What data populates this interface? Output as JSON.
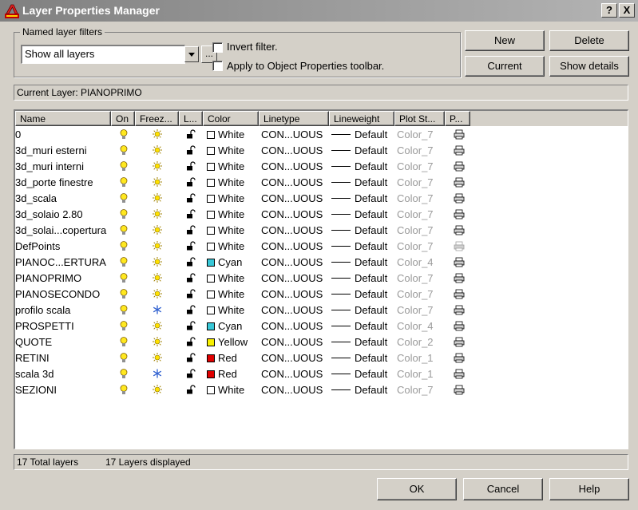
{
  "window": {
    "title": "Layer Properties Manager",
    "help_label": "?",
    "close_label": "X"
  },
  "filters": {
    "group_label": "Named layer filters",
    "selected": "Show all layers",
    "more_label": "...",
    "invert_label": "Invert filter.",
    "apply_label": "Apply to Object Properties toolbar."
  },
  "buttons": {
    "new": "New",
    "delete": "Delete",
    "current": "Current",
    "show_details": "Show details",
    "ok": "OK",
    "cancel": "Cancel",
    "help": "Help"
  },
  "current_layer": "Current Layer:  PIANOPRIMO",
  "columns": [
    "Name",
    "On",
    "Freez...",
    "L...",
    "Color",
    "Linetype",
    "Lineweight",
    "Plot St...",
    "P..."
  ],
  "colors": {
    "White": "#ffffff",
    "Cyan": "#38c8d8",
    "Yellow": "#f8f000",
    "Red": "#e00000"
  },
  "layers": [
    {
      "name": "0",
      "frozen": false,
      "color": "White",
      "linetype": "CON...UOUS",
      "lineweight": "Default",
      "plot_style": "Color_7",
      "plot": true
    },
    {
      "name": "3d_muri esterni",
      "frozen": false,
      "color": "White",
      "linetype": "CON...UOUS",
      "lineweight": "Default",
      "plot_style": "Color_7",
      "plot": true
    },
    {
      "name": "3d_muri interni",
      "frozen": false,
      "color": "White",
      "linetype": "CON...UOUS",
      "lineweight": "Default",
      "plot_style": "Color_7",
      "plot": true
    },
    {
      "name": "3d_porte finestre",
      "frozen": false,
      "color": "White",
      "linetype": "CON...UOUS",
      "lineweight": "Default",
      "plot_style": "Color_7",
      "plot": true
    },
    {
      "name": "3d_scala",
      "frozen": false,
      "color": "White",
      "linetype": "CON...UOUS",
      "lineweight": "Default",
      "plot_style": "Color_7",
      "plot": true
    },
    {
      "name": "3d_solaio 2.80",
      "frozen": false,
      "color": "White",
      "linetype": "CON...UOUS",
      "lineweight": "Default",
      "plot_style": "Color_7",
      "plot": true
    },
    {
      "name": "3d_solai...copertura",
      "frozen": false,
      "color": "White",
      "linetype": "CON...UOUS",
      "lineweight": "Default",
      "plot_style": "Color_7",
      "plot": true
    },
    {
      "name": "DefPoints",
      "frozen": false,
      "color": "White",
      "linetype": "CON...UOUS",
      "lineweight": "Default",
      "plot_style": "Color_7",
      "plot": false
    },
    {
      "name": "PIANOC...ERTURA",
      "frozen": false,
      "color": "Cyan",
      "linetype": "CON...UOUS",
      "lineweight": "Default",
      "plot_style": "Color_4",
      "plot": true
    },
    {
      "name": "PIANOPRIMO",
      "frozen": false,
      "color": "White",
      "linetype": "CON...UOUS",
      "lineweight": "Default",
      "plot_style": "Color_7",
      "plot": true
    },
    {
      "name": "PIANOSECONDO",
      "frozen": false,
      "color": "White",
      "linetype": "CON...UOUS",
      "lineweight": "Default",
      "plot_style": "Color_7",
      "plot": true
    },
    {
      "name": "profilo scala",
      "frozen": true,
      "color": "White",
      "linetype": "CON...UOUS",
      "lineweight": "Default",
      "plot_style": "Color_7",
      "plot": true
    },
    {
      "name": "PROSPETTI",
      "frozen": false,
      "color": "Cyan",
      "linetype": "CON...UOUS",
      "lineweight": "Default",
      "plot_style": "Color_4",
      "plot": true
    },
    {
      "name": "QUOTE",
      "frozen": false,
      "color": "Yellow",
      "linetype": "CON...UOUS",
      "lineweight": "Default",
      "plot_style": "Color_2",
      "plot": true
    },
    {
      "name": "RETINI",
      "frozen": false,
      "color": "Red",
      "linetype": "CON...UOUS",
      "lineweight": "Default",
      "plot_style": "Color_1",
      "plot": true
    },
    {
      "name": "scala 3d",
      "frozen": true,
      "color": "Red",
      "linetype": "CON...UOUS",
      "lineweight": "Default",
      "plot_style": "Color_1",
      "plot": true
    },
    {
      "name": "SEZIONI",
      "frozen": false,
      "color": "White",
      "linetype": "CON...UOUS",
      "lineweight": "Default",
      "plot_style": "Color_7",
      "plot": true
    }
  ],
  "status": {
    "total": "17 Total layers",
    "displayed": "17 Layers displayed"
  }
}
